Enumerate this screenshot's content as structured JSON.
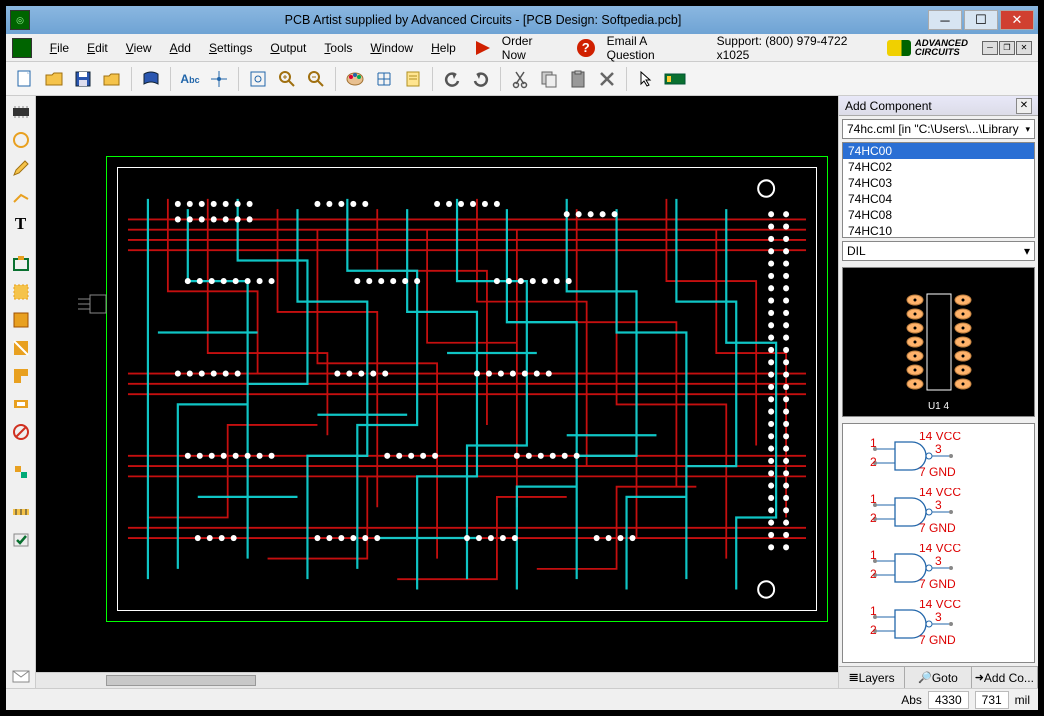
{
  "window": {
    "title": "PCB Artist supplied by Advanced Circuits - [PCB Design: Softpedia.pcb]"
  },
  "menu": {
    "file": "File",
    "edit": "Edit",
    "view": "View",
    "add": "Add",
    "settings": "Settings",
    "output": "Output",
    "tools": "Tools",
    "window": "Window",
    "help": "Help",
    "order": "Order Now",
    "email": "Email A Question",
    "support": "Support: (800) 979-4722 x1025",
    "brand": "ADVANCED CIRCUITS"
  },
  "add_component": {
    "title": "Add Component",
    "library": "74hc.cml   [in \"C:\\Users\\...\\Library",
    "parts": [
      "74HC00",
      "74HC02",
      "74HC03",
      "74HC04",
      "74HC08",
      "74HC10"
    ],
    "selected": "74HC00",
    "package": "DIL",
    "preview_label": "U1 4",
    "gate_pins": {
      "top": "14 VCC",
      "mid": "3",
      "bot": "7 GND"
    },
    "tabs": {
      "layers": "Layers",
      "goto": "Goto",
      "addco": "Add Co..."
    }
  },
  "status": {
    "abs": "Abs",
    "x": "4330",
    "y": "731",
    "unit": "mil"
  }
}
